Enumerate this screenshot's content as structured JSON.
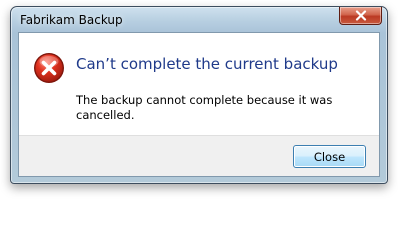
{
  "window": {
    "title": "Fabrikam Backup",
    "close_icon": "close-icon"
  },
  "dialog": {
    "icon": "error-icon",
    "heading": "Can’t complete the current backup",
    "message": "The backup cannot complete because it was cancelled."
  },
  "footer": {
    "close_label": "Close"
  },
  "colors": {
    "heading": "#1f3a8a",
    "error_red": "#d42b1e",
    "button_border": "#3c7fb1",
    "title_close_red": "#c24a31"
  }
}
